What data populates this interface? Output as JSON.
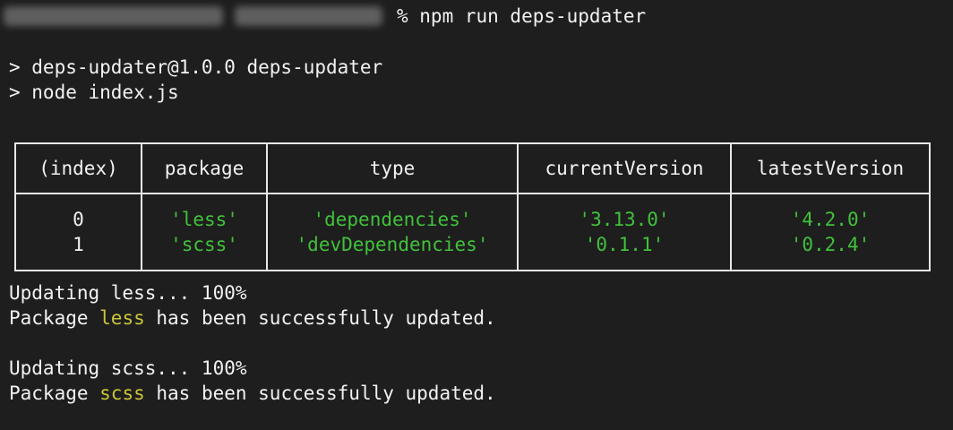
{
  "prompt": {
    "command": "% npm run deps-updater"
  },
  "output_header": [
    "> deps-updater@1.0.0 deps-updater",
    "> node index.js"
  ],
  "table": {
    "columns": [
      "(index)",
      "package",
      "type",
      "currentVersion",
      "latestVersion"
    ],
    "rows": [
      [
        "0",
        "'less'",
        "'dependencies'",
        "'3.13.0'",
        "'4.2.0'"
      ],
      [
        "1",
        "'scss'",
        "'devDependencies'",
        "'0.1.1'",
        "'0.2.4'"
      ]
    ]
  },
  "updates": [
    {
      "progress": "Updating less... 100%",
      "prefix": "Package ",
      "name": "less",
      "suffix": " has been successfully updated."
    },
    {
      "progress": "Updating scss... 100%",
      "prefix": "Package ",
      "name": "scss",
      "suffix": " has been successfully updated."
    }
  ],
  "colors": {
    "background": "#1e1e1e",
    "string": "#41c13b",
    "package_name": "#c9c53a",
    "text": "#f2f2f2"
  }
}
